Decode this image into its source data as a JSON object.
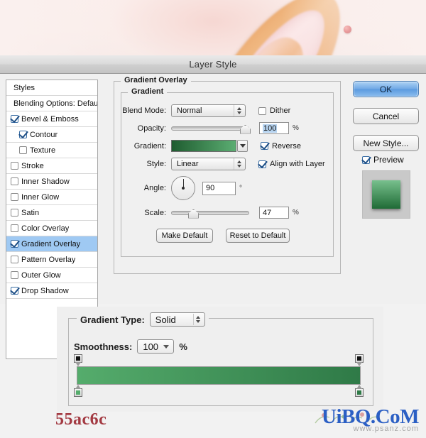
{
  "window": {
    "title": "Layer Style"
  },
  "styles_panel": {
    "header_label": "Styles",
    "blending_options_label": "Blending Options: Default",
    "items": [
      {
        "label": "Bevel & Emboss",
        "checked": true,
        "indent": false,
        "selected": false
      },
      {
        "label": "Contour",
        "checked": true,
        "indent": true,
        "selected": false
      },
      {
        "label": "Texture",
        "checked": false,
        "indent": true,
        "selected": false
      },
      {
        "label": "Stroke",
        "checked": false,
        "indent": false,
        "selected": false
      },
      {
        "label": "Inner Shadow",
        "checked": false,
        "indent": false,
        "selected": false
      },
      {
        "label": "Inner Glow",
        "checked": false,
        "indent": false,
        "selected": false
      },
      {
        "label": "Satin",
        "checked": false,
        "indent": false,
        "selected": false
      },
      {
        "label": "Color Overlay",
        "checked": false,
        "indent": false,
        "selected": false
      },
      {
        "label": "Gradient Overlay",
        "checked": true,
        "indent": false,
        "selected": true
      },
      {
        "label": "Pattern Overlay",
        "checked": false,
        "indent": false,
        "selected": false
      },
      {
        "label": "Outer Glow",
        "checked": false,
        "indent": false,
        "selected": false
      },
      {
        "label": "Drop Shadow",
        "checked": true,
        "indent": false,
        "selected": false
      }
    ]
  },
  "gradient_overlay": {
    "section_title": "Gradient Overlay",
    "subsection_title": "Gradient",
    "blend_mode": {
      "label": "Blend Mode:",
      "value": "Normal"
    },
    "dither": {
      "label": "Dither",
      "checked": false
    },
    "opacity": {
      "label": "Opacity:",
      "value": "100",
      "unit": "%",
      "slider_pct": 100
    },
    "gradient": {
      "label": "Gradient:",
      "start_color": "#1f5c30",
      "end_color": "#5bad72"
    },
    "reverse": {
      "label": "Reverse",
      "checked": true
    },
    "style": {
      "label": "Style:",
      "value": "Linear"
    },
    "align_with_layer": {
      "label": "Align with Layer",
      "checked": true
    },
    "angle": {
      "label": "Angle:",
      "value": "90",
      "unit": "°"
    },
    "scale": {
      "label": "Scale:",
      "value": "47",
      "unit": "%",
      "slider_pct": 22
    },
    "make_default_label": "Make Default",
    "reset_to_default_label": "Reset to Default"
  },
  "buttons": {
    "ok": "OK",
    "cancel": "Cancel",
    "new_style": "New Style...",
    "preview": {
      "label": "Preview",
      "checked": true
    }
  },
  "preview_thumbnail": {
    "start_color": "#78c08d",
    "end_color": "#1f6b36"
  },
  "gradient_editor": {
    "gradient_type": {
      "label": "Gradient Type:",
      "value": "Solid"
    },
    "smoothness": {
      "label": "Smoothness:",
      "value": "100",
      "unit": "%"
    },
    "ramp": {
      "start_color": "#55ac6c",
      "end_color": "#2f7a47",
      "opacity_stops": [
        {
          "position_pct": 0,
          "color": "#111111"
        },
        {
          "position_pct": 100,
          "color": "#111111"
        }
      ],
      "color_stops": [
        {
          "position_pct": 0,
          "color": "#55ac6c"
        },
        {
          "position_pct": 100,
          "color": "#2f7a47"
        }
      ]
    }
  },
  "caption": {
    "hex_label": "55ac6c",
    "hex_color": "#a33a42"
  },
  "watermark": {
    "main": "UiBQ.CoM",
    "sub": "www.psanz.com",
    "color": "#2b5fc4"
  }
}
